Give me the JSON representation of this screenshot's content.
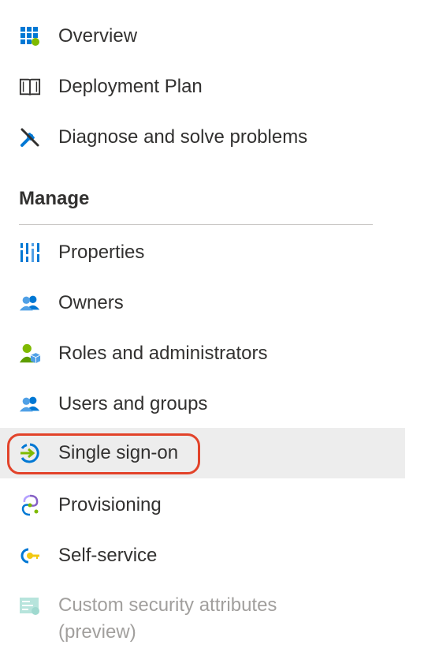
{
  "nav": {
    "items": [
      {
        "id": "overview",
        "label": "Overview",
        "icon": "overview-grid-icon"
      },
      {
        "id": "deployment-plan",
        "label": "Deployment Plan",
        "icon": "book-icon"
      },
      {
        "id": "diagnose",
        "label": "Diagnose and solve problems",
        "icon": "wrench-screwdriver-icon"
      }
    ],
    "manage_header": "Manage",
    "manage_items": [
      {
        "id": "properties",
        "label": "Properties",
        "icon": "properties-bars-icon"
      },
      {
        "id": "owners",
        "label": "Owners",
        "icon": "users-icon"
      },
      {
        "id": "roles",
        "label": "Roles and administrators",
        "icon": "user-role-icon"
      },
      {
        "id": "users-groups",
        "label": "Users and groups",
        "icon": "users-icon"
      },
      {
        "id": "sso",
        "label": "Single sign-on",
        "icon": "sign-in-arrow-icon",
        "selected": true
      },
      {
        "id": "provisioning",
        "label": "Provisioning",
        "icon": "provisioning-icon"
      },
      {
        "id": "self-service",
        "label": "Self-service",
        "icon": "key-icon"
      }
    ],
    "custom_security": {
      "line1": "Custom security attributes",
      "line2": "(preview)",
      "icon": "attributes-icon",
      "disabled": true
    }
  },
  "colors": {
    "selected_bg": "#ededed",
    "highlight_ring": "#e2432a",
    "text": "#323130",
    "disabled_text": "#a19f9d",
    "divider": "#c8c6c4",
    "azure_blue": "#0078d4"
  }
}
